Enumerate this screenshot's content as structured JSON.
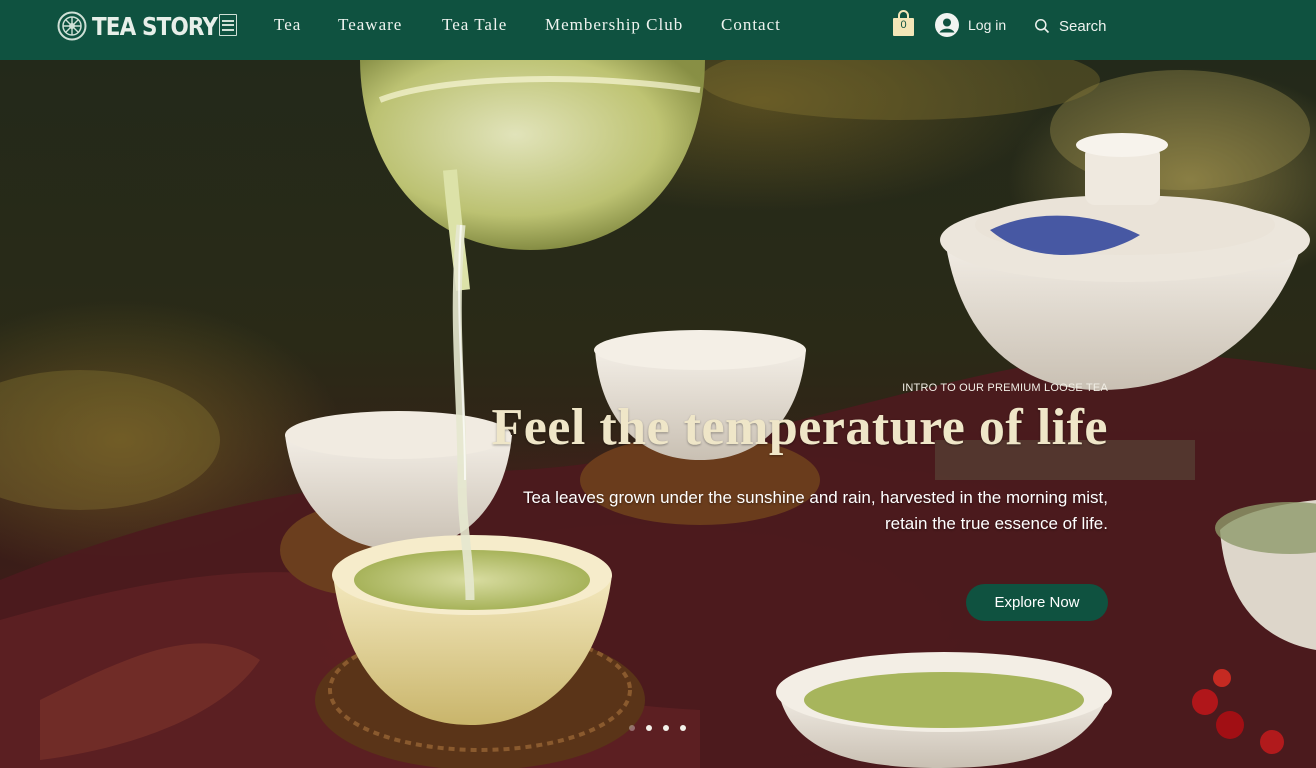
{
  "brand": {
    "name": "TEA STORY"
  },
  "nav": {
    "items": [
      {
        "label": "Tea"
      },
      {
        "label": "Teaware"
      },
      {
        "label": "Tea Tale"
      },
      {
        "label": "Membership Club"
      },
      {
        "label": "Contact"
      }
    ]
  },
  "header": {
    "cart_count": "0",
    "login_label": "Log in",
    "search_label": "Search"
  },
  "hero": {
    "kicker": "INTRO TO OUR PREMIUM LOOSE TEA",
    "headline": "Feel the temperature of life",
    "subtext_line1": "Tea leaves grown under the sunshine and rain, harvested in the morning mist,",
    "subtext_line2": "retain the true essence of life.",
    "cta_label": "Explore Now",
    "slides": 4,
    "active_slide": 1
  },
  "colors": {
    "brand_green": "#0f5240",
    "headline_cream": "#efe6c8",
    "nav_text": "#eef3ef"
  },
  "icons": [
    "tea-emblem-icon",
    "seal-icon",
    "shopping-bag-icon",
    "user-avatar-icon",
    "search-icon"
  ]
}
